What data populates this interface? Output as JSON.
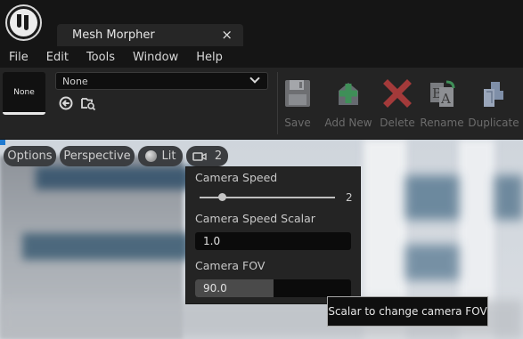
{
  "window": {
    "tab_title": "Mesh Morpher",
    "tab_close": "×"
  },
  "menu": [
    "File",
    "Edit",
    "Tools",
    "Window",
    "Help"
  ],
  "toolbar": {
    "thumbnail_label": "None",
    "asset_select_value": "None",
    "buttons": [
      {
        "label": "Save",
        "icon": "floppy-disk-icon"
      },
      {
        "label": "Add New",
        "icon": "add-mesh-icon"
      },
      {
        "label": "Delete",
        "icon": "delete-x-icon"
      },
      {
        "label": "Rename",
        "icon": "rename-icon"
      },
      {
        "label": "Duplicate",
        "icon": "duplicate-icon"
      }
    ],
    "disabled_label_color": "#6c6c6c"
  },
  "viewport": {
    "options_label": "Options",
    "perspective_label": "Perspective",
    "lit_label": "Lit",
    "camera_speed_badge": "2"
  },
  "camera_menu": {
    "speed_label": "Camera Speed",
    "speed_value": "2",
    "speed_fraction": 0.17,
    "speed_scalar_label": "Camera Speed Scalar",
    "speed_scalar_value": "1.0",
    "fov_label": "Camera FOV",
    "fov_value": "90.0",
    "fov_fill_fraction": 0.5
  },
  "tooltip": {
    "text": "Scalar to change camera FOV"
  },
  "colors": {
    "accent": "#1f7ad0",
    "add_green": "#3f8f58",
    "delete_red": "#a33a3a"
  }
}
